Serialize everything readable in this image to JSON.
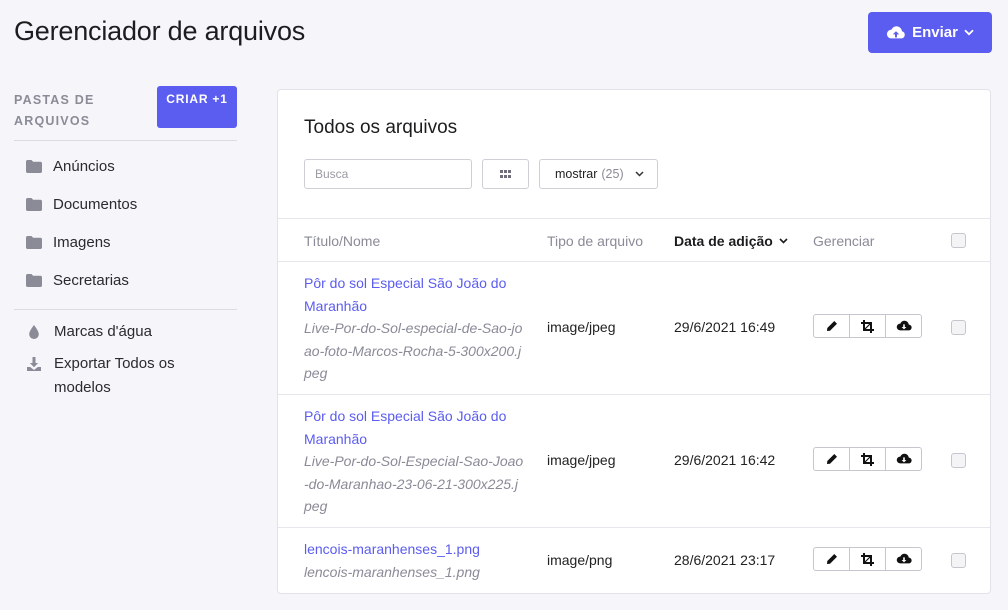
{
  "header": {
    "title": "Gerenciador de arquivos",
    "upload_label": "Enviar"
  },
  "sidebar": {
    "heading": "PASTAS DE ARQUIVOS",
    "create_label": "CRIAR +1",
    "folders": [
      {
        "label": "Anúncios",
        "icon": "folder-icon"
      },
      {
        "label": "Documentos",
        "icon": "folder-icon"
      },
      {
        "label": "Imagens",
        "icon": "folder-icon"
      },
      {
        "label": "Secretarias",
        "icon": "folder-icon"
      }
    ],
    "extras": [
      {
        "label": "Marcas d'água",
        "icon": "water-drop-icon"
      },
      {
        "label": "Exportar Todos os modelos",
        "icon": "download-icon"
      }
    ]
  },
  "panel": {
    "title": "Todos os arquivos",
    "search_placeholder": "Busca",
    "show_label": "mostrar",
    "show_count": "(25)"
  },
  "table": {
    "columns": {
      "title": "Título/Nome",
      "type": "Tipo de arquivo",
      "date": "Data de adição",
      "manage": "Gerenciar"
    },
    "rows": [
      {
        "title": "Pôr do sol Especial São João do Maranhão",
        "filename": "Live-Por-do-Sol-especial-de-Sao-joao-foto-Marcos-Rocha-5-300x200.jpeg",
        "type": "image/jpeg",
        "date": "29/6/2021 16:49"
      },
      {
        "title": "Pôr do sol Especial São João do Maranhão",
        "filename": "Live-Por-do-Sol-Especial-Sao-Joao-do-Maranhao-23-06-21-300x225.jpeg",
        "type": "image/jpeg",
        "date": "29/6/2021 16:42"
      },
      {
        "title": "lencois-maranhenses_1.png",
        "filename": "lencois-maranhenses_1.png",
        "type": "image/png",
        "date": "28/6/2021 23:17"
      }
    ]
  },
  "colors": {
    "accent": "#5b5cf0",
    "muted": "#8a8b97",
    "background": "#f6f6fa"
  }
}
